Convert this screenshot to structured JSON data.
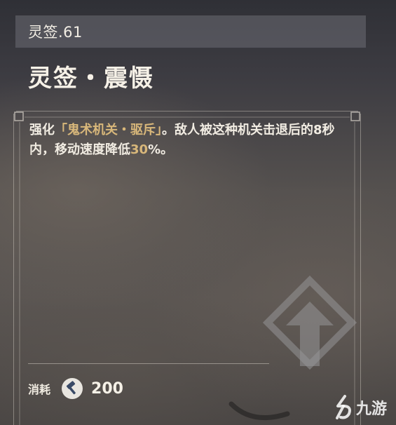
{
  "header": {
    "label": "灵签.61"
  },
  "card": {
    "title": "灵签・震慑",
    "description": {
      "part1": "强化",
      "highlight": "「鬼术机关・驱斥」",
      "part2": "。敌人被这种机关击退后的8秒内，移动速度降低",
      "number": "30",
      "part3": "%。"
    }
  },
  "cost": {
    "label": "消耗",
    "icon": "hammer-coin-icon",
    "value": "200"
  },
  "emblem": {
    "icon": "upgrade-arrow-emblem-icon"
  },
  "watermark": {
    "text": "九游",
    "icon": "jiuyou-logo-icon"
  },
  "colors": {
    "highlight": "#d8b77a",
    "text": "#f1ece2"
  }
}
